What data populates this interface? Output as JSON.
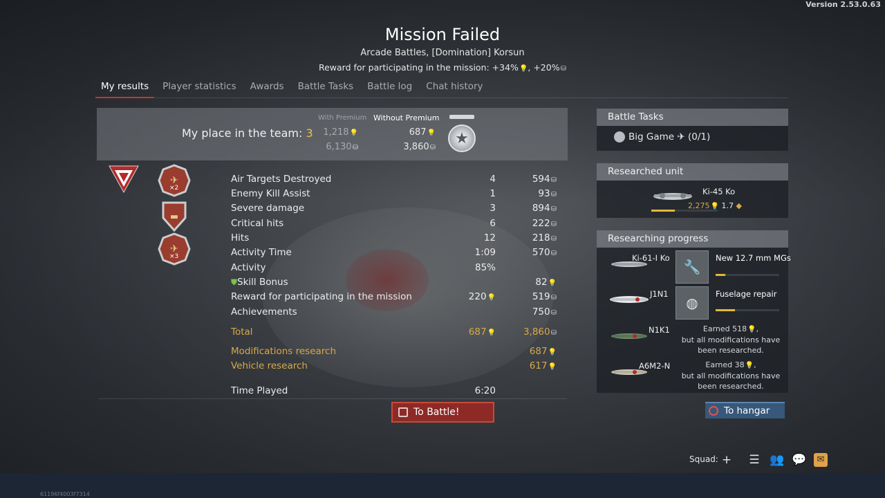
{
  "version": "Version 2.53.0.63",
  "header": {
    "title": "Mission Failed",
    "subtitle": "Arcade Battles, [Domination] Korsun",
    "reward": "Reward for participating in the mission: +34%",
    "reward_sep": ", +20%"
  },
  "tabs": [
    "My results",
    "Player statistics",
    "Awards",
    "Battle Tasks",
    "Battle log",
    "Chat history"
  ],
  "team": {
    "label": "My place in the team: ",
    "place": "3",
    "col_with_premium": "With Premium",
    "col_without_premium": "Without Premium",
    "with_rp": "1,218",
    "with_lions": "6,130",
    "without_rp": "687",
    "without_lions": "3,860"
  },
  "awards": [
    {
      "name": "award-aircraft-x2",
      "mult": "×2"
    },
    {
      "name": "award-tank",
      "mult": ""
    },
    {
      "name": "award-aircraft-x3",
      "mult": "×3"
    }
  ],
  "stats": [
    {
      "label": "Air Targets Destroyed",
      "v1": "4",
      "v2": "594"
    },
    {
      "label": "Enemy Kill Assist",
      "v1": "1",
      "v2": "93"
    },
    {
      "label": "Severe damage",
      "v1": "3",
      "v2": "894"
    },
    {
      "label": "Critical hits",
      "v1": "6",
      "v2": "222"
    },
    {
      "label": "Hits",
      "v1": "12",
      "v2": "218"
    },
    {
      "label": "Activity Time",
      "v1": "1:09",
      "v2": "570"
    },
    {
      "label": "Activity",
      "v1": "85%",
      "v2": ""
    },
    {
      "label": "Skill Bonus",
      "v1": "",
      "v2": "82"
    },
    {
      "label": "Reward for participating in the mission",
      "v1": "220",
      "v2": "519"
    },
    {
      "label": "Achievements",
      "v1": "",
      "v2": "750"
    }
  ],
  "totals": {
    "total_label": "Total",
    "total_rp": "687",
    "total_lions": "3,860",
    "mod_label": "Modifications research",
    "mod_rp": "687",
    "veh_label": "Vehicle research",
    "veh_rp": "617",
    "time_label": "Time Played",
    "time_value": "6:20"
  },
  "buttons": {
    "battle": "To Battle!",
    "hangar": "To hangar"
  },
  "battle_tasks": {
    "title": "Battle Tasks",
    "task": "Big Game",
    "progress": "(0/1)"
  },
  "researched_unit": {
    "title": "Researched unit",
    "name": "Ki-45 Ko",
    "rp": "2,275",
    "br": "1.7",
    "progress": 0.35
  },
  "researching": {
    "title": "Researching progress",
    "vehicles": [
      {
        "name": "Ki-61-I Ko",
        "mod": "New 12.7 mm MGs",
        "mod_progress": 0.15
      },
      {
        "name": "J1N1",
        "mod": "Fuselage repair",
        "mod_progress": 0.3
      },
      {
        "name": "N1K1",
        "earned_1": "Earned 518",
        "earned_2": "but all modifications have",
        "earned_3": "been researched."
      },
      {
        "name": "A6M2-N",
        "earned_1": "Earned 38",
        "earned_2": "but all modifications have",
        "earned_3": "been researched."
      }
    ]
  },
  "footer": {
    "squad": "Squad:",
    "session": "61196f4003f7314"
  },
  "colors": {
    "gold": "#d8a94a",
    "battle_button": "#8d2a26",
    "hangar_button": "#37587a",
    "rp_blue": "#7fd3f0"
  }
}
